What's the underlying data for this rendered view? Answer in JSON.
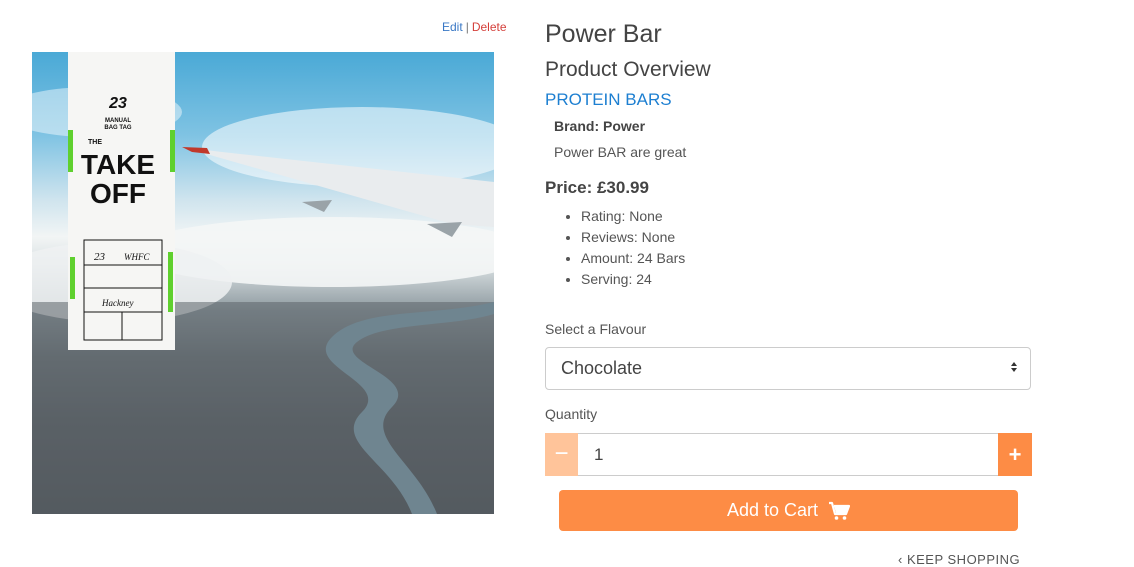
{
  "admin": {
    "edit_label": "Edit",
    "separator": "|",
    "delete_label": "Delete"
  },
  "image": {
    "description": "Aerial view of London from a plane window with a luggage tag"
  },
  "product": {
    "title": "Power Bar",
    "subtitle": "Product Overview",
    "category": "PROTEIN BARS",
    "brand": "Brand: Power",
    "description": "Power BAR are great",
    "price": "Price: £30.99",
    "specs": [
      "Rating: None",
      "Reviews: None",
      "Amount: 24 Bars",
      "Serving: 24"
    ]
  },
  "flavour": {
    "label": "Select a Flavour",
    "selected": "Chocolate"
  },
  "quantity": {
    "label": "Quantity",
    "value": "1",
    "minus_label": "−",
    "plus_label": "+"
  },
  "cart": {
    "add_label": "Add to Cart"
  },
  "keep_shopping": {
    "label": "KEEP SHOPPING",
    "icon": "chevron-left-icon"
  },
  "colors": {
    "accent": "#fd8c45",
    "link": "#1d7fd1",
    "delete": "#d43f3a"
  }
}
